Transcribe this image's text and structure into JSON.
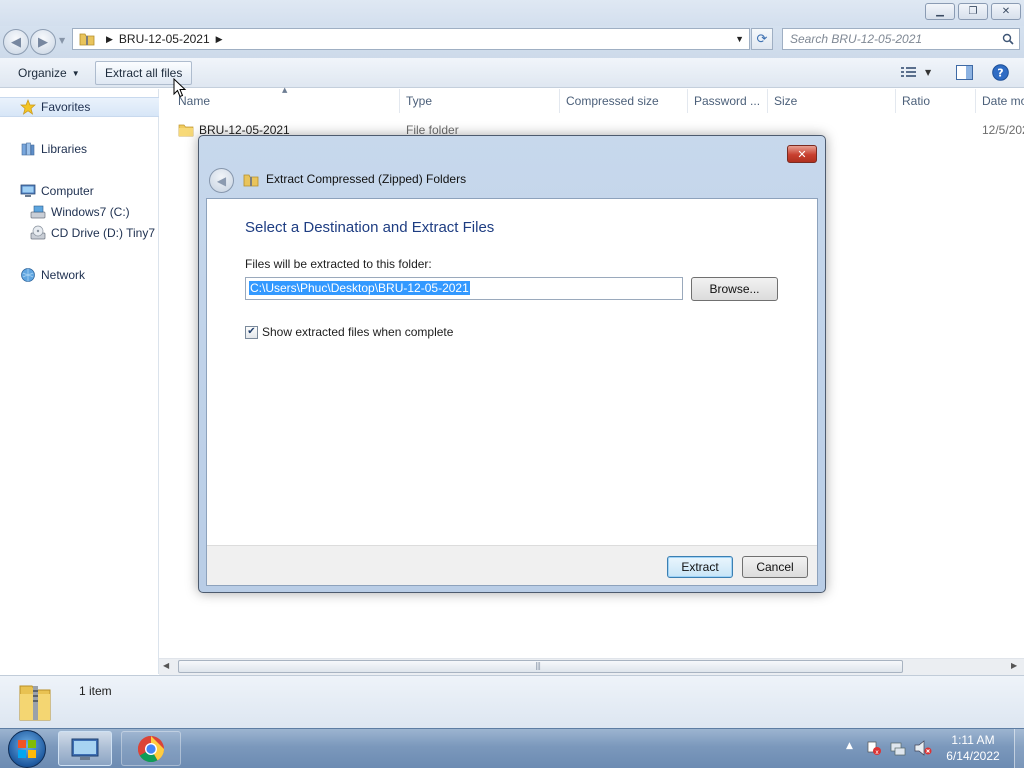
{
  "explorer": {
    "address_path": "BRU-12-05-2021",
    "search_placeholder": "Search BRU-12-05-2021",
    "toolbar": {
      "organize": "Organize",
      "extract_all": "Extract all files"
    },
    "nav": {
      "favorites": "Favorites",
      "libraries": "Libraries",
      "computer": "Computer",
      "drive_c": "Windows7 (C:)",
      "drive_d": "CD Drive (D:) Tiny7",
      "network": "Network"
    },
    "columns": [
      "Name",
      "Type",
      "Compressed size",
      "Password ...",
      "Size",
      "Ratio",
      "Date mo"
    ],
    "items": [
      {
        "name": "BRU-12-05-2021",
        "type": "File folder",
        "date": "12/5/202"
      }
    ],
    "status": {
      "item_count": "1 item"
    }
  },
  "dialog": {
    "title": "Extract Compressed (Zipped) Folders",
    "heading": "Select a Destination and Extract Files",
    "path_label": "Files will be extracted to this folder:",
    "path_value": "C:\\Users\\Phuc\\Desktop\\BRU-12-05-2021",
    "browse_label": "Browse...",
    "checkbox_label": "Show extracted files when complete",
    "checkbox_checked": true,
    "extract_label": "Extract",
    "cancel_label": "Cancel"
  },
  "taskbar": {
    "time": "1:11 AM",
    "date": "6/14/2022"
  },
  "icons": {
    "back": "back-arrow-icon",
    "forward": "forward-arrow-icon",
    "folder": "folder-icon",
    "zip": "zip-folder-icon",
    "star": "star-icon",
    "refresh": "refresh-icon",
    "search": "search-icon",
    "close": "close-icon",
    "help": "help-icon",
    "chrome": "chrome-icon",
    "start": "windows-start-icon"
  },
  "colors": {
    "accent": "#3399ff",
    "selection": "#3399ff",
    "dialog_heading": "#1e3d82",
    "close_red": "#c8402f"
  }
}
